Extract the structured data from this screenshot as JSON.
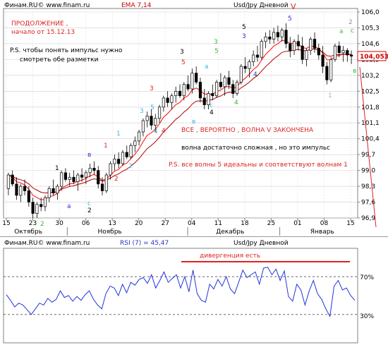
{
  "price_panel": {
    "header_left": "Финам.RU© www.finam.ru",
    "indicator_label": "EMA 7,14",
    "instrument": "Usd/Jpy Дневной",
    "current_price": "104,053"
  },
  "rsi_panel": {
    "header_left": "Финам.RU© www.finam.ru",
    "indicator_label": "RSI (7) = 45,47",
    "instrument": "Usd/Jpy Дневной",
    "level_70": "70%",
    "level_30": "30%"
  },
  "annotations": {
    "continuation_title": "ПРОДОЛЖЕНИЕ ,",
    "continuation_start": "начало  от 15.12.13",
    "ps_line1": "P.S. чтобы понять импульс нужно",
    "ps_line2": "смотреть обе разметки",
    "wave_v_done": "ВСЕ  , ВЕРОЯТНО ,  ВОЛНА  V  ЗАКОНЧЕНА",
    "wave_note": "волна       достаточно сложная , но это импульс",
    "ps_waves": "P.S. все волны 5 идеальны и соответствуют волнам 1",
    "divergence": "дивергенция  есть",
    "top_v": "V"
  },
  "wave_labels": [
    {
      "text": "2",
      "color": "#2fbf2f"
    },
    {
      "text": "a",
      "color": "#3030cc"
    },
    {
      "text": "1",
      "color": "#000000"
    },
    {
      "text": "в",
      "color": "#3030cc"
    },
    {
      "text": "c",
      "color": "#33bbdd"
    },
    {
      "text": "2",
      "color": "#000000"
    },
    {
      "text": "1",
      "color": "#dd2222"
    },
    {
      "text": "2",
      "color": "#dd2222"
    },
    {
      "text": "1",
      "color": "#33bbdd"
    },
    {
      "text": "2",
      "color": "#33bbdd"
    },
    {
      "text": "3",
      "color": "#33bbdd"
    },
    {
      "text": "3",
      "color": "#dd2222"
    },
    {
      "text": "5",
      "color": "#33bbdd"
    },
    {
      "text": "4",
      "color": "#dd2222"
    },
    {
      "text": "4",
      "color": "#33bbdd"
    },
    {
      "text": "3",
      "color": "#000000"
    },
    {
      "text": "5",
      "color": "#dd2222"
    },
    {
      "text": "a",
      "color": "#33bbdd"
    },
    {
      "text": "в",
      "color": "#33bbdd"
    },
    {
      "text": "c",
      "color": "#33bbdd"
    },
    {
      "text": "4",
      "color": "#000000"
    },
    {
      "text": "3",
      "color": "#2fbf2f"
    },
    {
      "text": "5",
      "color": "#2fbf2f"
    },
    {
      "text": "5",
      "color": "#000000"
    },
    {
      "text": "4",
      "color": "#2fbf2f"
    },
    {
      "text": "4",
      "color": "#3030cc"
    },
    {
      "text": "3",
      "color": "#3030cc"
    },
    {
      "text": "5",
      "color": "#3030cc"
    },
    {
      "text": "1",
      "color": "#aaaacc"
    },
    {
      "text": "2",
      "color": "#999999"
    },
    {
      "text": "a",
      "color": "#2fbf2f"
    },
    {
      "text": "c",
      "color": "#2fbf2f"
    },
    {
      "text": "в",
      "color": "#2fbf2f"
    }
  ],
  "chart_data": [
    {
      "type": "candlestick",
      "title": "Usd/Jpy Дневной",
      "indicators": [
        "EMA 7,14"
      ],
      "y_ticks": [
        "106,0",
        "105,3",
        "104,6",
        "103,9",
        "103,2",
        "102,5",
        "101,8",
        "101,1",
        "100,4",
        "99,7",
        "99,0",
        "98,3",
        "97,6",
        "96,9"
      ],
      "ylim": [
        96.9,
        106.0
      ],
      "x_ticks": [
        "15",
        "23",
        "30",
        "06",
        "13",
        "20",
        "27",
        "04",
        "11",
        "18",
        "25",
        "01",
        "08",
        "15"
      ],
      "month_labels": [
        "Октябрь",
        "Ноябрь",
        "Декабрь",
        "Январь"
      ],
      "last_price": 104.053,
      "ohlc": [
        [
          98.2,
          98.9,
          97.9,
          98.8
        ],
        [
          98.8,
          99.0,
          98.3,
          98.4
        ],
        [
          98.4,
          98.7,
          97.7,
          97.9
        ],
        [
          97.9,
          98.4,
          97.6,
          98.3
        ],
        [
          98.3,
          98.6,
          97.9,
          98.1
        ],
        [
          98.1,
          98.3,
          97.4,
          97.6
        ],
        [
          97.6,
          97.8,
          96.9,
          97.1
        ],
        [
          97.1,
          97.6,
          96.9,
          97.5
        ],
        [
          97.5,
          97.8,
          97.2,
          97.4
        ],
        [
          97.4,
          97.9,
          97.2,
          97.8
        ],
        [
          97.8,
          98.3,
          97.6,
          98.2
        ],
        [
          98.2,
          98.6,
          97.9,
          98.0
        ],
        [
          98.0,
          98.4,
          97.7,
          98.3
        ],
        [
          98.3,
          99.0,
          98.1,
          98.9
        ],
        [
          98.9,
          99.1,
          98.5,
          98.6
        ],
        [
          98.6,
          98.9,
          98.3,
          98.7
        ],
        [
          98.7,
          99.0,
          98.4,
          98.5
        ],
        [
          98.5,
          98.9,
          98.1,
          98.8
        ],
        [
          98.8,
          99.1,
          98.5,
          98.7
        ],
        [
          98.7,
          99.0,
          98.4,
          98.9
        ],
        [
          98.9,
          99.3,
          98.7,
          99.1
        ],
        [
          99.1,
          99.4,
          98.8,
          99.0
        ],
        [
          99.0,
          99.2,
          98.2,
          98.4
        ],
        [
          98.4,
          98.7,
          97.9,
          98.1
        ],
        [
          98.1,
          98.9,
          98.0,
          98.8
        ],
        [
          98.8,
          99.4,
          98.6,
          99.3
        ],
        [
          99.3,
          99.7,
          99.0,
          99.5
        ],
        [
          99.5,
          99.8,
          99.1,
          99.3
        ],
        [
          99.3,
          99.9,
          99.2,
          99.8
        ],
        [
          99.8,
          100.1,
          99.5,
          99.6
        ],
        [
          99.6,
          100.2,
          99.5,
          100.1
        ],
        [
          100.1,
          100.5,
          99.8,
          100.3
        ],
        [
          100.3,
          100.8,
          100.1,
          100.7
        ],
        [
          100.7,
          101.3,
          100.5,
          101.2
        ],
        [
          101.2,
          101.6,
          100.9,
          101.4
        ],
        [
          101.4,
          101.7,
          100.8,
          101.0
        ],
        [
          101.0,
          101.5,
          100.7,
          101.3
        ],
        [
          101.3,
          101.9,
          101.1,
          101.8
        ],
        [
          101.8,
          102.3,
          101.6,
          102.2
        ],
        [
          102.2,
          102.5,
          101.8,
          102.0
        ],
        [
          102.0,
          102.4,
          101.7,
          102.3
        ],
        [
          102.3,
          102.7,
          102.0,
          102.5
        ],
        [
          102.5,
          102.8,
          102.2,
          102.3
        ],
        [
          102.3,
          102.9,
          102.1,
          102.8
        ],
        [
          102.8,
          103.2,
          102.5,
          102.6
        ],
        [
          102.6,
          103.5,
          102.4,
          103.3
        ],
        [
          103.3,
          103.6,
          102.8,
          102.9
        ],
        [
          102.9,
          103.1,
          102.0,
          102.2
        ],
        [
          102.2,
          102.6,
          101.7,
          101.9
        ],
        [
          101.9,
          102.5,
          101.7,
          102.4
        ],
        [
          102.4,
          102.8,
          102.1,
          102.3
        ],
        [
          102.3,
          103.0,
          102.2,
          102.9
        ],
        [
          102.9,
          103.3,
          102.6,
          102.7
        ],
        [
          102.7,
          103.2,
          102.3,
          103.1
        ],
        [
          103.1,
          103.4,
          102.6,
          102.8
        ],
        [
          102.8,
          103.0,
          102.2,
          102.4
        ],
        [
          102.4,
          103.0,
          102.3,
          102.9
        ],
        [
          102.9,
          103.7,
          102.8,
          103.6
        ],
        [
          103.6,
          104.0,
          103.3,
          103.5
        ],
        [
          103.5,
          103.9,
          103.1,
          103.8
        ],
        [
          103.8,
          104.3,
          103.6,
          104.1
        ],
        [
          104.1,
          104.5,
          103.8,
          104.0
        ],
        [
          104.0,
          104.8,
          103.9,
          104.7
        ],
        [
          104.7,
          105.1,
          104.4,
          104.9
        ],
        [
          104.9,
          105.2,
          104.6,
          104.8
        ],
        [
          104.8,
          105.3,
          104.6,
          105.1
        ],
        [
          105.1,
          105.4,
          104.7,
          104.9
        ],
        [
          104.9,
          105.3,
          104.7,
          105.2
        ],
        [
          105.2,
          105.5,
          104.4,
          104.6
        ],
        [
          104.6,
          104.9,
          104.0,
          104.3
        ],
        [
          104.3,
          104.8,
          104.1,
          104.7
        ],
        [
          104.7,
          105.0,
          104.3,
          104.5
        ],
        [
          104.5,
          104.9,
          103.7,
          103.9
        ],
        [
          103.9,
          104.4,
          103.6,
          104.3
        ],
        [
          104.3,
          104.9,
          104.1,
          104.8
        ],
        [
          104.8,
          105.1,
          104.2,
          104.4
        ],
        [
          104.4,
          104.6,
          103.9,
          104.1
        ],
        [
          104.1,
          104.5,
          103.3,
          103.6
        ],
        [
          103.6,
          103.8,
          102.8,
          103.0
        ],
        [
          103.0,
          104.0,
          102.9,
          103.9
        ],
        [
          103.9,
          104.6,
          103.8,
          104.5
        ],
        [
          104.5,
          104.7,
          104.0,
          104.2
        ],
        [
          104.2,
          104.5,
          103.8,
          104.3
        ],
        [
          104.3,
          104.4,
          103.8,
          104.1
        ],
        [
          104.1,
          104.3,
          103.7,
          104.05
        ]
      ]
    },
    {
      "type": "line",
      "title": "RSI (7) = 45,47",
      "ylim": [
        0,
        100
      ],
      "levels": [
        70,
        30
      ],
      "values": [
        51,
        45,
        38,
        42,
        40,
        35,
        30,
        36,
        42,
        40,
        47,
        43,
        46,
        55,
        48,
        50,
        44,
        49,
        45,
        51,
        55,
        46,
        40,
        36,
        52,
        60,
        58,
        50,
        62,
        53,
        64,
        61,
        67,
        69,
        63,
        72,
        58,
        66,
        75,
        64,
        68,
        72,
        58,
        70,
        54,
        77,
        52,
        45,
        43,
        62,
        57,
        67,
        60,
        70,
        57,
        52,
        64,
        77,
        69,
        72,
        75,
        62,
        79,
        80,
        72,
        78,
        66,
        76,
        49,
        44,
        62,
        56,
        40,
        55,
        66,
        52,
        46,
        36,
        28,
        60,
        66,
        56,
        58,
        50,
        45
      ]
    }
  ]
}
